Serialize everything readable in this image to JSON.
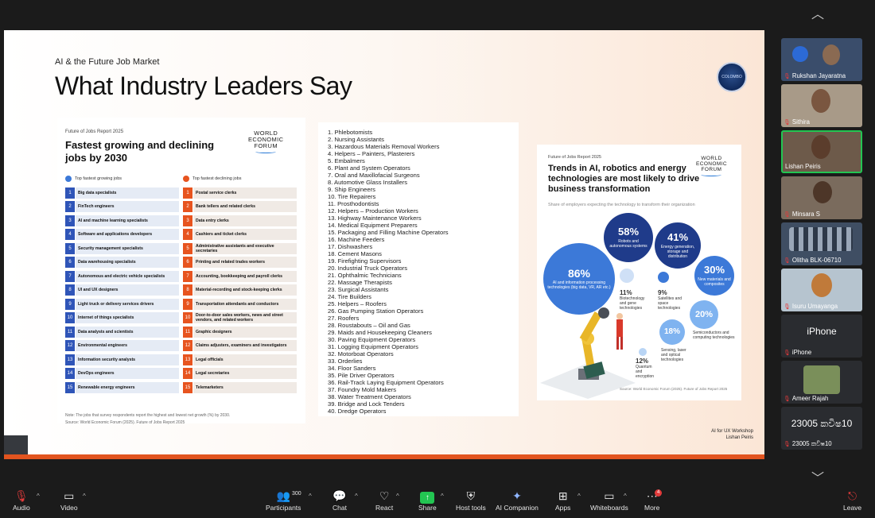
{
  "slide": {
    "subtitle": "AI & the Future Job Market",
    "title": "What Industry Leaders Say",
    "logo_text": "COLOMBO",
    "footer_line1": "AI for UX Workshop",
    "footer_line2": "Lishan Peiris"
  },
  "card1": {
    "report": "Future of Jobs Report 2025",
    "title": "Fastest growing and declining jobs by 2030",
    "wef_line1": "WORLD",
    "wef_line2": "ECONOMIC",
    "wef_line3": "FORUM",
    "growing_header": "Top fastest growing jobs",
    "declining_header": "Top fastest declining jobs",
    "growing": [
      {
        "n": "1",
        "label": "Big data specialists"
      },
      {
        "n": "2",
        "label": "FinTech engineers"
      },
      {
        "n": "3",
        "label": "AI and machine learning specialists"
      },
      {
        "n": "4",
        "label": "Software and applications developers"
      },
      {
        "n": "5",
        "label": "Security management specialists"
      },
      {
        "n": "6",
        "label": "Data warehousing specialists"
      },
      {
        "n": "7",
        "label": "Autonomous and electric vehicle specialists"
      },
      {
        "n": "8",
        "label": "UI and UX designers"
      },
      {
        "n": "9",
        "label": "Light truck or delivery services drivers"
      },
      {
        "n": "10",
        "label": "Internet of things specialists"
      },
      {
        "n": "11",
        "label": "Data analysts and scientists"
      },
      {
        "n": "12",
        "label": "Environmental engineers"
      },
      {
        "n": "13",
        "label": "Information security analysts"
      },
      {
        "n": "14",
        "label": "DevOps engineers"
      },
      {
        "n": "15",
        "label": "Renewable energy engineers"
      }
    ],
    "declining": [
      {
        "n": "1",
        "label": "Postal service clerks"
      },
      {
        "n": "2",
        "label": "Bank tellers and related clerks"
      },
      {
        "n": "3",
        "label": "Data entry clerks"
      },
      {
        "n": "4",
        "label": "Cashiers and ticket clerks"
      },
      {
        "n": "5",
        "label": "Administrative assistants and executive secretaries"
      },
      {
        "n": "6",
        "label": "Printing and related trades workers"
      },
      {
        "n": "7",
        "label": "Accounting, bookkeeping and payroll clerks"
      },
      {
        "n": "8",
        "label": "Material-recording and stock-keeping clerks"
      },
      {
        "n": "9",
        "label": "Transportation attendants and conductors"
      },
      {
        "n": "10",
        "label": "Door-to-door sales workers, news and street vendors, and related workers"
      },
      {
        "n": "11",
        "label": "Graphic designers"
      },
      {
        "n": "12",
        "label": "Claims adjusters, examiners and investigators"
      },
      {
        "n": "13",
        "label": "Legal officials"
      },
      {
        "n": "14",
        "label": "Legal secretaries"
      },
      {
        "n": "15",
        "label": "Telemarketers"
      }
    ],
    "note1": "Note: The jobs that survey respondents report the highest and lowest net growth (%) by 2030.",
    "note2": "Source: World Economic Forum (2025). Future of Jobs Report 2025"
  },
  "card2": {
    "items": [
      "1. Phlebotomists",
      "2. Nursing Assistants",
      "3. Hazardous Materials Removal Workers",
      "4. Helpers – Painters, Plasterers",
      "5. Embalmers",
      "6. Plant and System Operators",
      "7. Oral and Maxillofacial Surgeons",
      "8. Automotive Glass Installers",
      "9. Ship Engineers",
      "10. Tire Repairers",
      "11. Prosthodontists",
      "12. Helpers – Production Workers",
      "13. Highway Maintenance Workers",
      "14. Medical Equipment Preparers",
      "15. Packaging and Filling Machine Operators",
      "16. Machine Feeders",
      "17. Dishwashers",
      "18. Cement Masons",
      "19. Firefighting Supervisors",
      "20. Industrial Truck Operators",
      "21. Ophthalmic Technicians",
      "22. Massage Therapists",
      "23. Surgical Assistants",
      "24. Tire Builders",
      "25. Helpers – Roofers",
      "26. Gas Pumping Station Operators",
      "27. Roofers",
      "28. Roustabouts – Oil and Gas",
      "29. Maids and Housekeeping Cleaners",
      "30. Paving Equipment Operators",
      "31. Logging Equipment Operators",
      "32. Motorboat Operators",
      "33. Orderlies",
      "34. Floor Sanders",
      "35. Pile Driver Operators",
      "36. Rail-Track Laying Equipment Operators",
      "37. Foundry Mold Makers",
      "38. Water Treatment Operators",
      "39. Bridge and Lock Tenders",
      "40. Dredge Operators"
    ]
  },
  "card3": {
    "report": "Future of Jobs Report 2025",
    "title": "Trends in AI, robotics and energy technologies are most likely to drive business transformation",
    "subtitle": "Share of employers expecting the technology to transform their organization",
    "b86_pct": "86%",
    "b86_label": "AI and information processing technologies (big data, VR, AR etc.)",
    "b58_pct": "58%",
    "b58_label": "Robots and autonomous systems",
    "b41_pct": "41%",
    "b41_label": "Energy generation, storage and distribution",
    "b30_pct": "30%",
    "b30_label": "New materials and composites",
    "b20_pct": "20%",
    "b20_label": "Semiconductors and computing technologies",
    "b18_pct": "18%",
    "b18_label": "Sensing, laser and optical technologies",
    "b12_pct": "12%",
    "b12_label": "Quantum and encryption",
    "b11_pct": "11%",
    "b11_label": "Biotechnology and gene technologies",
    "b9_pct": "9%",
    "b9_label": "Satellites and space technologies",
    "source": "Source: World Economic Forum (2025). Future of Jobs Report 2025"
  },
  "participants": [
    {
      "name": "Rukshan Jayaratna"
    },
    {
      "name": "Sithira"
    },
    {
      "name": "Lishan Peiris"
    },
    {
      "name": "Minsara S"
    },
    {
      "name": "Olitha BLK-06710"
    },
    {
      "name": "Isuru Umayanga"
    },
    {
      "name": "iPhone",
      "big": "iPhone"
    },
    {
      "name": "Ameer Rajah"
    },
    {
      "name": "23005 කවිෂ10",
      "big": "23005 කවිෂ10"
    }
  ],
  "toolbar": {
    "audio": "Audio",
    "video": "Video",
    "participants": "Participants",
    "participants_count": "300",
    "chat": "Chat",
    "react": "React",
    "share": "Share",
    "host_tools": "Host tools",
    "ai_companion": "AI Companion",
    "apps": "Apps",
    "whiteboards": "Whiteboards",
    "more": "More",
    "more_badge": "4",
    "leave": "Leave"
  },
  "colors": {
    "growing": "#2f55b8",
    "declining": "#e7541f",
    "bubble_dark": "#1f3b8a",
    "bubble_mid": "#3c79d8",
    "bubble_light": "#7fb3f0",
    "active_speaker": "#23c552"
  }
}
